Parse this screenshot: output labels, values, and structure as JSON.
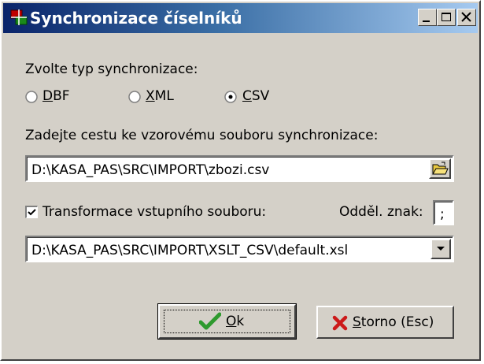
{
  "window": {
    "title": "Synchronizace číselníků"
  },
  "sync_type": {
    "label": "Zvolte typ synchronizace:",
    "options": [
      {
        "hotkey": "D",
        "rest": "BF",
        "selected": false
      },
      {
        "hotkey": "X",
        "rest": "ML",
        "selected": false
      },
      {
        "hotkey": "C",
        "rest": "SV",
        "selected": true
      }
    ]
  },
  "path": {
    "label": "Zadejte cestu ke vzorovému souboru synchronizace:",
    "value": "D:\\KASA_PAS\\SRC\\IMPORT\\zbozi.csv"
  },
  "transform": {
    "checked": true,
    "label": "Transformace vstupního souboru:",
    "separator_label": "Odděl. znak:",
    "separator_value": ";",
    "xsl_value": "D:\\KASA_PAS\\SRC\\IMPORT\\XSLT_CSV\\default.xsl"
  },
  "buttons": {
    "ok": {
      "hotkey": "O",
      "rest": "k"
    },
    "cancel": {
      "hotkey": "S",
      "rest": "torno (Esc)"
    }
  },
  "colors": {
    "title_bar": "#0a246a",
    "face": "#d4d0c8",
    "ok_check": "#2e9a2e",
    "cancel_x": "#cc1a1a"
  }
}
